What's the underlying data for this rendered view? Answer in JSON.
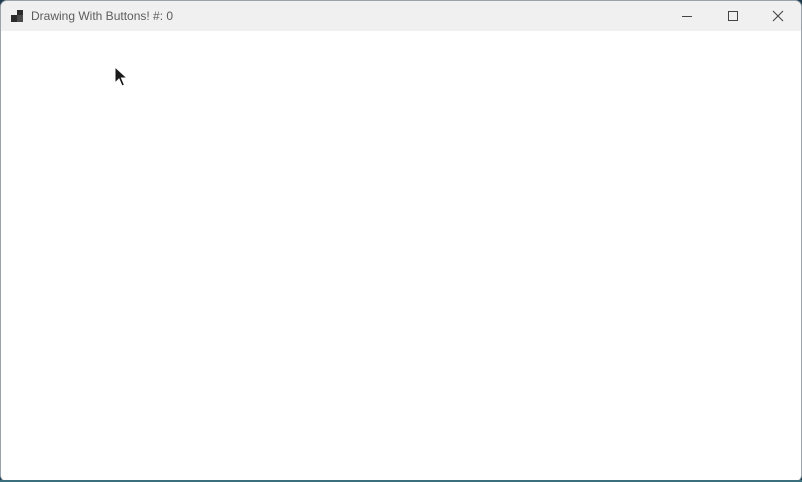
{
  "window": {
    "title": "Drawing With Buttons! #: 0"
  },
  "icons": {
    "app": "app-grid-icon",
    "minimize": "minimize-icon",
    "maximize": "maximize-icon",
    "close": "close-icon",
    "cursor": "mouse-pointer-icon"
  },
  "colors": {
    "titlebar": "#f0f0f0",
    "client": "#ffffff",
    "title_text": "#5c5c5c"
  }
}
